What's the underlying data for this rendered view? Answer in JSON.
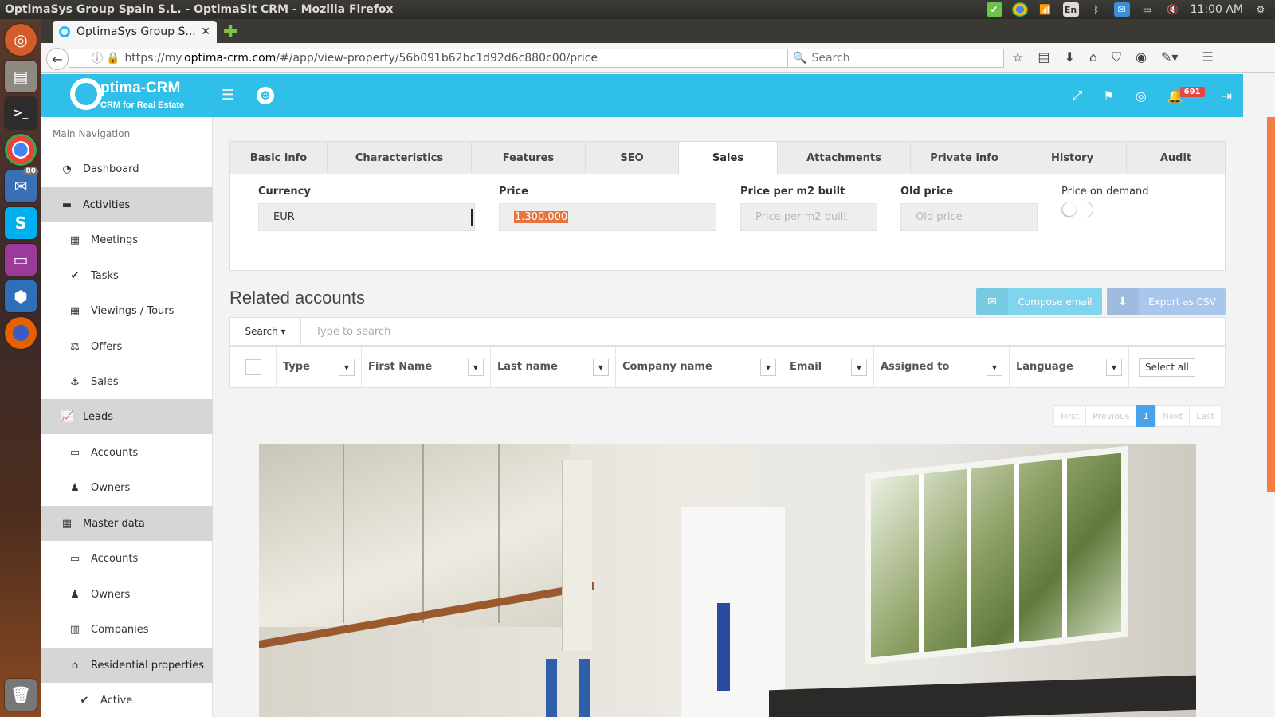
{
  "os": {
    "window_title": "OptimaSys Group Spain S.L. - OptimaSit CRM - Mozilla Firefox",
    "keyboard_layout": "En",
    "clock": "11:00 AM"
  },
  "launcher": {
    "badge_count": "80"
  },
  "browser": {
    "tab_title": "OptimaSys Group S...",
    "url_prefix": "https://my.",
    "url_domain": "optima-crm.com",
    "url_path": "/#/app/view-property/56b091b62bc1d92d6c880c00/price",
    "search_placeholder": "Search"
  },
  "app": {
    "brand_name": "ptima-CRM",
    "brand_tagline": "CRM for Real Estate",
    "notification_count": "691",
    "accent_color": "#30bfe9"
  },
  "sidebar": {
    "heading": "Main Navigation",
    "items": [
      {
        "label": "Dashboard",
        "icon": "dashboard-icon"
      },
      {
        "label": "Activities",
        "icon": "archive-icon"
      },
      {
        "label": "Meetings",
        "icon": "calendar-icon"
      },
      {
        "label": "Tasks",
        "icon": "check-icon"
      },
      {
        "label": "Viewings / Tours",
        "icon": "calendar-icon"
      },
      {
        "label": "Offers",
        "icon": "gavel-icon"
      },
      {
        "label": "Sales",
        "icon": "anchor-icon"
      },
      {
        "label": "Leads",
        "icon": "chart-icon"
      },
      {
        "label": "Accounts",
        "icon": "card-icon"
      },
      {
        "label": "Owners",
        "icon": "user-icon"
      },
      {
        "label": "Master data",
        "icon": "grid-icon"
      },
      {
        "label": "Accounts",
        "icon": "card-icon"
      },
      {
        "label": "Owners",
        "icon": "user-icon"
      },
      {
        "label": "Companies",
        "icon": "building-icon"
      },
      {
        "label": "Residential properties",
        "icon": "home-icon"
      },
      {
        "label": "Active",
        "icon": "check-icon"
      }
    ]
  },
  "tabs": [
    "Basic info",
    "Characteristics",
    "Features",
    "SEO",
    "Sales",
    "Attachments",
    "Private info",
    "History",
    "Audit"
  ],
  "sales_form": {
    "currency_label": "Currency",
    "currency_value": "EUR",
    "price_label": "Price",
    "price_value": "1.300.000",
    "price_m2_label": "Price per m2 built",
    "price_m2_placeholder": "Price per m2 built",
    "old_price_label": "Old price",
    "old_price_placeholder": "Old price",
    "price_on_demand_label": "Price on demand"
  },
  "related_accounts": {
    "title": "Related accounts",
    "compose_email": "Compose email",
    "export_csv": "Export as CSV",
    "search_dropdown": "Search",
    "search_placeholder": "Type to search",
    "columns": [
      "Type",
      "First Name",
      "Last name",
      "Company name",
      "Email",
      "Assigned to",
      "Language"
    ],
    "select_all": "Select all",
    "pager": {
      "first": "First",
      "previous": "Previous",
      "current": "1",
      "next": "Next",
      "last": "Last"
    }
  }
}
